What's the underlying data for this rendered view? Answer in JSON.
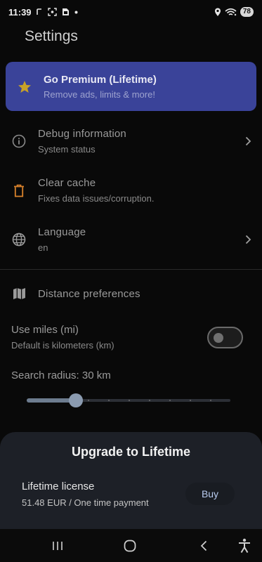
{
  "status_bar": {
    "time": "11:39",
    "battery": "78",
    "left_icons": [
      "r-icon",
      "screenshot-icon",
      "sim-icon",
      "dot-icon"
    ],
    "right_icons": [
      "location-icon",
      "wifi-icon"
    ]
  },
  "page": {
    "title": "Settings"
  },
  "premium": {
    "title": "Go Premium (Lifetime)",
    "subtitle": "Remove ads, limits & more!",
    "star_color": "#c9a227",
    "background_color": "#3a4399"
  },
  "settings": [
    {
      "id": "debug",
      "title": "Debug information",
      "subtitle": "System status",
      "icon": "info-icon",
      "has_chevron": true
    },
    {
      "id": "cache",
      "title": "Clear cache",
      "subtitle": "Fixes data issues/corruption.",
      "icon": "trash-icon",
      "icon_color": "#d9822b",
      "has_chevron": false
    },
    {
      "id": "language",
      "title": "Language",
      "subtitle": "en",
      "icon": "globe-icon",
      "has_chevron": true
    }
  ],
  "distance": {
    "title": "Distance preferences",
    "icon": "map-icon",
    "miles": {
      "title": "Use miles (mi)",
      "subtitle": "Default is kilometers (km)",
      "enabled": false
    },
    "radius": {
      "label": "Search radius: 30 km",
      "value_fraction": 0.22,
      "steps": 10
    }
  },
  "upgrade_sheet": {
    "title": "Upgrade to Lifetime",
    "item_title": "Lifetime license",
    "item_subtitle": "51.48 EUR / One time payment",
    "buy_label": "Buy",
    "accent_color": "#b9ccf0"
  },
  "nav_bar": {
    "buttons": [
      "recents-icon",
      "home-icon",
      "back-icon",
      "accessibility-icon"
    ]
  }
}
